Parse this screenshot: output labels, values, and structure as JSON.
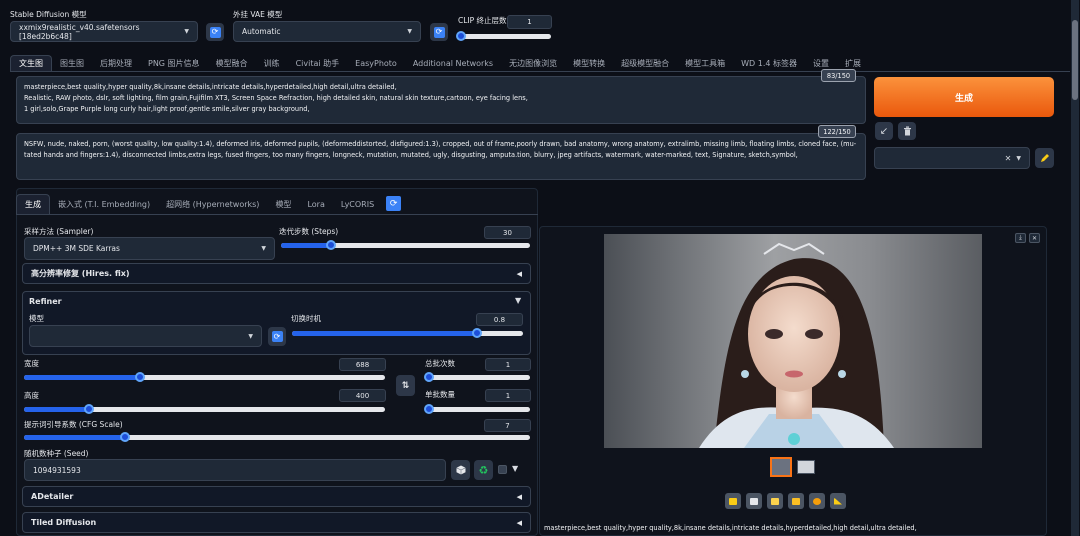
{
  "top": {
    "sd_model_label": "Stable Diffusion 模型",
    "sd_model_value": "xxmix9realistic_v40.safetensors [18ed2b6c48]",
    "vae_label": "外挂 VAE 模型",
    "vae_value": "Automatic",
    "clip_label": "CLIP 终止层数",
    "clip_value": "1",
    "clip_level": 0.0
  },
  "main_tabs": [
    "文生图",
    "图生图",
    "后期处理",
    "PNG 图片信息",
    "模型融合",
    "训练",
    "Civitai 助手",
    "EasyPhoto",
    "Additional Networks",
    "无边图像浏览",
    "模型转换",
    "超级模型融合",
    "模型工具箱",
    "WD 1.4 标签器",
    "设置",
    "扩展"
  ],
  "prompt": {
    "text": "masterpiece,best quality,hyper quality,8k,insane details,intricate details,hyperdetailed,high detail,ultra detailed,\nRealistic, RAW photo, dslr, soft lighting, film grain,Fujifilm XT3, Screen Space Refraction, high detailed skin, natural skin texture,cartoon, eye facing lens,\n1 girl,solo,Grape Purple long curly hair,light proof,gentle smile,silver gray background,",
    "counter": "83/150"
  },
  "negative": {
    "text": "NSFW, nude, naked, porn, (worst quality, low quality:1.4), deformed iris, deformed pupils, (deformeddistorted, disfigured:1.3), cropped, out of frame,poorly drawn, bad anatomy, wrong anatomy, extralimb, missing limb, floating limbs, cloned face, (mu-tated hands and fingers:1.4), disconnected limbs,extra legs, fused fingers, too many fingers, longneck, mutation, mutated, ugly, disgusting, amputa.tion, blurry, jpeg artifacts, watermark, water-marked, text, Signature, sketch,symbol,",
    "counter": "122/150"
  },
  "generate_label": "生成",
  "sub_tabs": [
    "生成",
    "嵌入式 (T.I. Embedding)",
    "超网络 (Hypernetworks)",
    "模型",
    "Lora",
    "LyCORIS"
  ],
  "sampler": {
    "label": "采样方法 (Sampler)",
    "value": "DPM++ 3M SDE Karras"
  },
  "steps": {
    "label": "迭代步数 (Steps)",
    "value": "30",
    "level": 0.2
  },
  "hires": "高分辨率修复 (Hires. fix)",
  "refiner": {
    "title": "Refiner",
    "model_label": "模型",
    "switch_label": "切换时机",
    "switch_value": "0.8",
    "switch_level": 0.8
  },
  "width": {
    "label": "宽度",
    "value": "688",
    "level": 0.32
  },
  "height": {
    "label": "高度",
    "value": "400",
    "level": 0.18
  },
  "batch_count": {
    "label": "总批次数",
    "value": "1",
    "level": 0.0
  },
  "batch_size": {
    "label": "单批数量",
    "value": "1",
    "level": 0.0
  },
  "cfg": {
    "label": "提示词引导系数 (CFG Scale)",
    "value": "7",
    "level": 0.2
  },
  "seed": {
    "label": "随机数种子 (Seed)",
    "value": "1094931593"
  },
  "adetailer": "ADetailer",
  "tiled": "Tiled Diffusion",
  "output_caption": "masterpiece,best quality,hyper quality,8k,insane details,intricate details,hyperdetailed,high detail,ultra detailed,",
  "colors": {
    "accent": "#f97316",
    "slider": "#2563eb",
    "bg": "#0c0f17",
    "panel": "#111827"
  }
}
